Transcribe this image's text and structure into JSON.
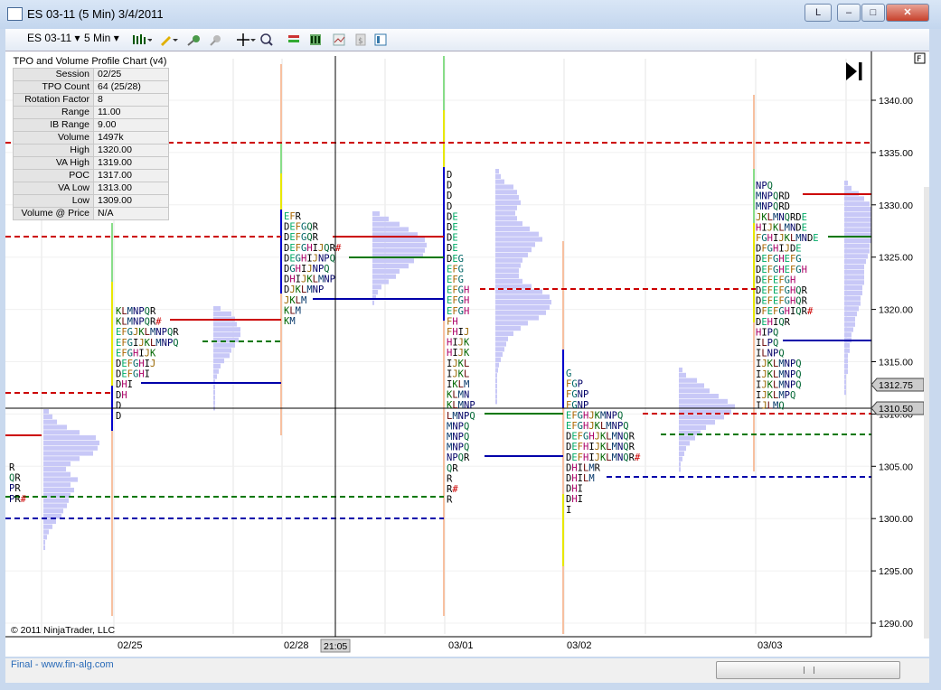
{
  "window": {
    "title": "ES 03-11 (5 Min)  3/4/2011",
    "link_btn": "L"
  },
  "toolbar": {
    "instrument": "ES 03-11",
    "interval": "5 Min"
  },
  "info_table": {
    "title": "TPO and Volume Profile Chart (v4)",
    "rows": [
      {
        "k": "Session",
        "v": "02/25"
      },
      {
        "k": "TPO Count",
        "v": "64 (25/28)"
      },
      {
        "k": "Rotation Factor",
        "v": "8"
      },
      {
        "k": "Range",
        "v": "11.00"
      },
      {
        "k": "IB Range",
        "v": "9.00"
      },
      {
        "k": "Volume",
        "v": "1497k"
      },
      {
        "k": "High",
        "v": "1320.00"
      },
      {
        "k": "VA High",
        "v": "1319.00"
      },
      {
        "k": "POC",
        "v": "1317.00"
      },
      {
        "k": "VA Low",
        "v": "1313.00"
      },
      {
        "k": "Low",
        "v": "1309.00"
      },
      {
        "k": "Volume @ Price",
        "v": "N/A"
      }
    ]
  },
  "price_axis": [
    "1340.00",
    "1335.00",
    "1330.00",
    "1325.00",
    "1320.00",
    "1315.00",
    "1310.00",
    "1305.00",
    "1300.00",
    "1295.00",
    "1290.00"
  ],
  "price_labels": {
    "last": "1312.75",
    "crosshair": "1310.50"
  },
  "date_axis": [
    "02/25",
    "02/28",
    "03/01",
    "03/02",
    "03/03"
  ],
  "time_label": "21:05",
  "copyright": "© 2011 NinjaTrader, LLC",
  "footer": "Final - www.fin-alg.com",
  "panel_letter": "F",
  "colors": {
    "background": "#ffffff",
    "profile": "#c8c8f7",
    "value_high": "#cc0000",
    "poc": "#007700",
    "value_low": "#0000aa"
  },
  "chart_data": {
    "type": "table",
    "sessions": [
      {
        "date": "02/25",
        "tpo": [
          "EFR",
          "DEFGQR",
          "DEFGQR",
          "DEFGHIJQR#",
          "DEGHIJNPQ",
          "DGHIJNPQ",
          "DHIJKLMNP",
          "DJKLMNP",
          "JKLM",
          "KLM",
          "KM"
        ]
      },
      {
        "date": "02/25 prev",
        "tpo": [
          "KLMNPQR",
          "KLMNPQR#",
          "EFGJKLMNPQR",
          "EFGIJKLMNPQ",
          "EFGHIJK",
          "DEFGHIJ",
          "DEFGHI",
          "DHI",
          "DH",
          "D",
          "D"
        ]
      },
      {
        "date": "03/01",
        "tpo": [
          "D",
          "D",
          "D",
          "D",
          "DE",
          "DE",
          "DE",
          "DE",
          "DEG",
          "EFG",
          "EFG",
          "EFGH",
          "EFGH",
          "EFGH",
          "FH",
          "FHIJ",
          "HIJK",
          "HIJK",
          "IJKL",
          "IJKL",
          "IKLM",
          "KLMN",
          "KLMNP",
          "LMNPQ",
          "MNPQ",
          "MNPQ",
          "MNPQ",
          "NPQR",
          "QR",
          "R",
          "R#",
          "R"
        ]
      },
      {
        "date": "03/02",
        "tpo": [
          "G",
          "FGP",
          "FGNP",
          "FGNP",
          "EFGHJKMNPQ",
          "EFGHJKLMNPQ",
          "DEFGHJKLMNQR",
          "DEFHIJKLMNQR",
          "DEFHIJKLMNQR#",
          "DHILMR",
          "DHILM",
          "DHI",
          "DHI",
          "I"
        ]
      },
      {
        "date": "03/03",
        "tpo": [
          "NPQ",
          "MNPQRD",
          "MNPQRD",
          "JKLMNQRDE",
          "HIJKLMNDE",
          "FGHIJKLMNDE",
          "DFGHIJDE",
          "DEFGHEFG",
          "DEFGHEFGH",
          "DEFEFGH",
          "DEFEFGHQR",
          "DEFEFGHQR",
          "DFEFGHIQR#",
          "DEHIQR",
          "HIPQ",
          "ILPQ",
          "ILNPQ",
          "IJKLMNPQ",
          "IJKLMNPQ",
          "IJKLMNPQ",
          "IJKLMPQ",
          "IJLMQ"
        ]
      }
    ],
    "levels": [
      {
        "session": "02/25",
        "vah": 1319,
        "poc": 1317,
        "val": 1313
      },
      {
        "session": "03/01",
        "vah": 1322,
        "poc": 1310,
        "val": 1306
      },
      {
        "session": "03/02",
        "vah": 1310,
        "poc": 1308,
        "val": 1304
      },
      {
        "session": "03/03",
        "vah": 1331,
        "poc": 1327,
        "val": 1317
      }
    ]
  }
}
